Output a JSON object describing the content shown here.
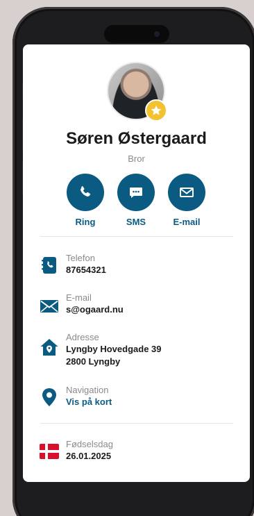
{
  "contact": {
    "name": "Søren Østergaard",
    "relation": "Bror",
    "is_favorite": true
  },
  "actions": [
    {
      "label": "Ring",
      "icon": "phone-icon"
    },
    {
      "label": "SMS",
      "icon": "message-icon"
    },
    {
      "label": "E-mail",
      "icon": "envelope-icon"
    }
  ],
  "details": {
    "phone": {
      "label": "Telefon",
      "value": "87654321",
      "icon": "phonebook-icon"
    },
    "email": {
      "label": "E-mail",
      "value": "s@ogaard.nu",
      "icon": "envelope-icon"
    },
    "address": {
      "label": "Adresse",
      "line1": "Lyngby Hovedgade 39",
      "line2": "2800 Lyngby",
      "icon": "home-location-icon"
    },
    "navigation": {
      "label": "Navigation",
      "value": "Vis på kort",
      "icon": "map-pin-icon"
    },
    "birthday": {
      "label": "Fødselsdag",
      "value": "26.01.2025",
      "icon": "danish-flag-icon"
    }
  },
  "colors": {
    "accent": "#0b5a82",
    "favorite": "#f2c230",
    "flag_red": "#d8102c"
  }
}
